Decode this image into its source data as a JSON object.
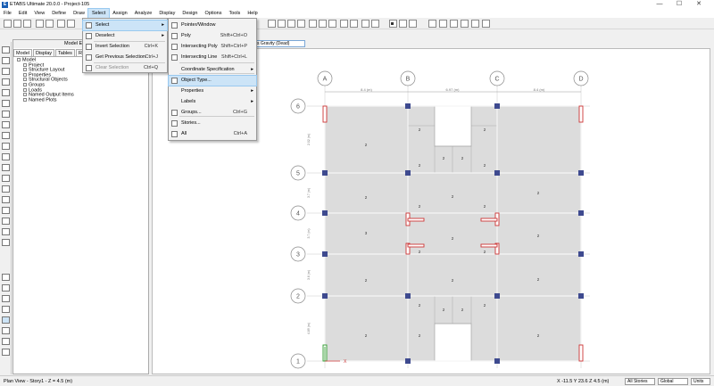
{
  "window": {
    "title": "ETABS Ultimate 20.0.0 - Project-105",
    "minimize": "—",
    "maximize": "☐",
    "close": "✕"
  },
  "menubar": [
    "File",
    "Edit",
    "View",
    "Define",
    "Draw",
    "Select",
    "Assign",
    "Analyze",
    "Display",
    "Design",
    "Options",
    "Tools",
    "Help"
  ],
  "explorer": {
    "title": "Model Explorer",
    "tabs": [
      "Model",
      "Display",
      "Tables",
      "Reports"
    ],
    "tree": [
      {
        "label": "Model",
        "indent": 0
      },
      {
        "label": "Project",
        "indent": 1
      },
      {
        "label": "Structure Layout",
        "indent": 1
      },
      {
        "label": "Properties",
        "indent": 1
      },
      {
        "label": "Structural Objects",
        "indent": 1
      },
      {
        "label": "Groups",
        "indent": 1
      },
      {
        "label": "Loads",
        "indent": 1
      },
      {
        "label": "Named Output Items",
        "indent": 1
      },
      {
        "label": "Named Plots",
        "indent": 1
      }
    ]
  },
  "view_tab": {
    "label": "s Gravity (Dead)"
  },
  "select_menu": {
    "items": [
      {
        "label": "Select",
        "shortcut": "",
        "submenu": true,
        "highlighted": true,
        "disabled": false,
        "icon": "select-arrow-icon"
      },
      {
        "label": "Deselect",
        "shortcut": "",
        "submenu": true,
        "highlighted": false,
        "disabled": false,
        "icon": "deselect-icon"
      },
      {
        "label": "Invert Selection",
        "shortcut": "Ctrl+K",
        "submenu": false,
        "highlighted": false,
        "disabled": false,
        "icon": "invert-selection-icon"
      },
      {
        "label": "Get Previous Selection",
        "shortcut": "Ctrl+J",
        "submenu": false,
        "highlighted": false,
        "disabled": false,
        "icon": "previous-selection-icon"
      },
      {
        "label": "Clear Selection",
        "shortcut": "Ctrl+Q",
        "submenu": false,
        "highlighted": false,
        "disabled": true,
        "icon": "clear-selection-icon"
      }
    ]
  },
  "select_submenu": {
    "items": [
      {
        "label": "Pointer/Window",
        "shortcut": "",
        "submenu": false,
        "highlighted": false,
        "icon": "pointer-icon"
      },
      {
        "label": "Poly",
        "shortcut": "Shift+Ctrl+O",
        "submenu": false,
        "highlighted": false,
        "icon": "poly-icon"
      },
      {
        "label": "Intersecting Poly",
        "shortcut": "Shift+Ctrl+P",
        "submenu": false,
        "highlighted": false,
        "icon": "intersecting-poly-icon"
      },
      {
        "label": "Intersecting Line",
        "shortcut": "Shift+Ctrl+L",
        "submenu": false,
        "highlighted": false,
        "icon": "intersecting-line-icon"
      },
      {
        "label": "Coordinate Specification",
        "shortcut": "",
        "submenu": true,
        "highlighted": false,
        "icon": ""
      },
      {
        "label": "Object Type...",
        "shortcut": "",
        "submenu": false,
        "highlighted": true,
        "icon": "object-type-icon"
      },
      {
        "label": "Properties",
        "shortcut": "",
        "submenu": true,
        "highlighted": false,
        "icon": ""
      },
      {
        "label": "Labels",
        "shortcut": "",
        "submenu": true,
        "highlighted": false,
        "icon": ""
      },
      {
        "label": "Groups...",
        "shortcut": "Ctrl+G",
        "submenu": false,
        "highlighted": false,
        "icon": "groups-icon"
      },
      {
        "label": "Stories...",
        "shortcut": "",
        "submenu": false,
        "highlighted": false,
        "icon": "stories-icon"
      },
      {
        "label": "All",
        "shortcut": "Ctrl+A",
        "submenu": false,
        "highlighted": false,
        "icon": "select-all-icon"
      }
    ]
  },
  "plan": {
    "grid_x": [
      "A",
      "B",
      "C",
      "D"
    ],
    "grid_y": [
      "6",
      "5",
      "4",
      "3",
      "2",
      "1"
    ],
    "bay_dims": [
      "8.4 (m)",
      "6.97 (m)",
      "8.4 (m)"
    ],
    "story_dims": [
      "2.02 (m)",
      "3.7 (m)",
      "3.7 (m)",
      "3.6 (m)",
      "4.89 (m)"
    ],
    "slab_labels": [
      "2",
      "2",
      "2",
      "2",
      "2",
      "2",
      "2",
      "2",
      "2",
      "2",
      "2",
      "2",
      "3",
      "2",
      "2",
      "2",
      "2",
      "2",
      "2",
      "2",
      "2",
      "2",
      "2",
      "2",
      "2",
      "2",
      "2"
    ],
    "axis_x_label": "X"
  },
  "status": {
    "view": "Plan View - Story1 - Z = 4.5 (m)",
    "coords": "X -11.5  Y 23.6  Z 4.5 (m)",
    "stories": "All Stories",
    "coord_sys": "Global",
    "units": "Units"
  },
  "colors": {
    "accent": "#cce4f7",
    "slab": "#dcdcdc",
    "column": "#3e4a8f",
    "wall": "#cc3333"
  }
}
